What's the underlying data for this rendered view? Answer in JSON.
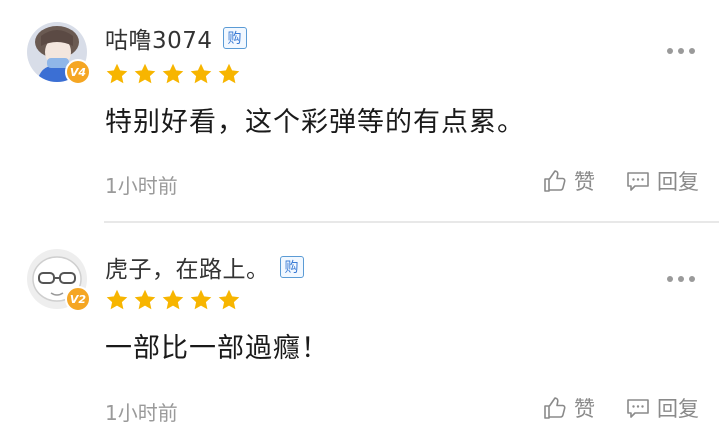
{
  "comments": [
    {
      "username": "咕噜3074",
      "level": "V4",
      "buy_badge": "购",
      "rating": 5,
      "content": "特别好看，这个彩弹等的有点累。",
      "time": "1小时前",
      "like_label": "赞",
      "reply_label": "回复"
    },
    {
      "username": "虎子，在路上。",
      "level": "V2",
      "buy_badge": "购",
      "rating": 5,
      "content": "一部比一部過癮！",
      "time": "1小时前",
      "like_label": "赞",
      "reply_label": "回复"
    }
  ],
  "colors": {
    "star": "#f7b500",
    "level_badge": "#f5a623",
    "buy_badge_border": "#5b9bd5",
    "divider": "#e8e8e8"
  },
  "icons": {
    "like": "thumbs-up-icon",
    "reply": "comment-icon",
    "more": "more-dots-icon",
    "star": "star-icon"
  }
}
